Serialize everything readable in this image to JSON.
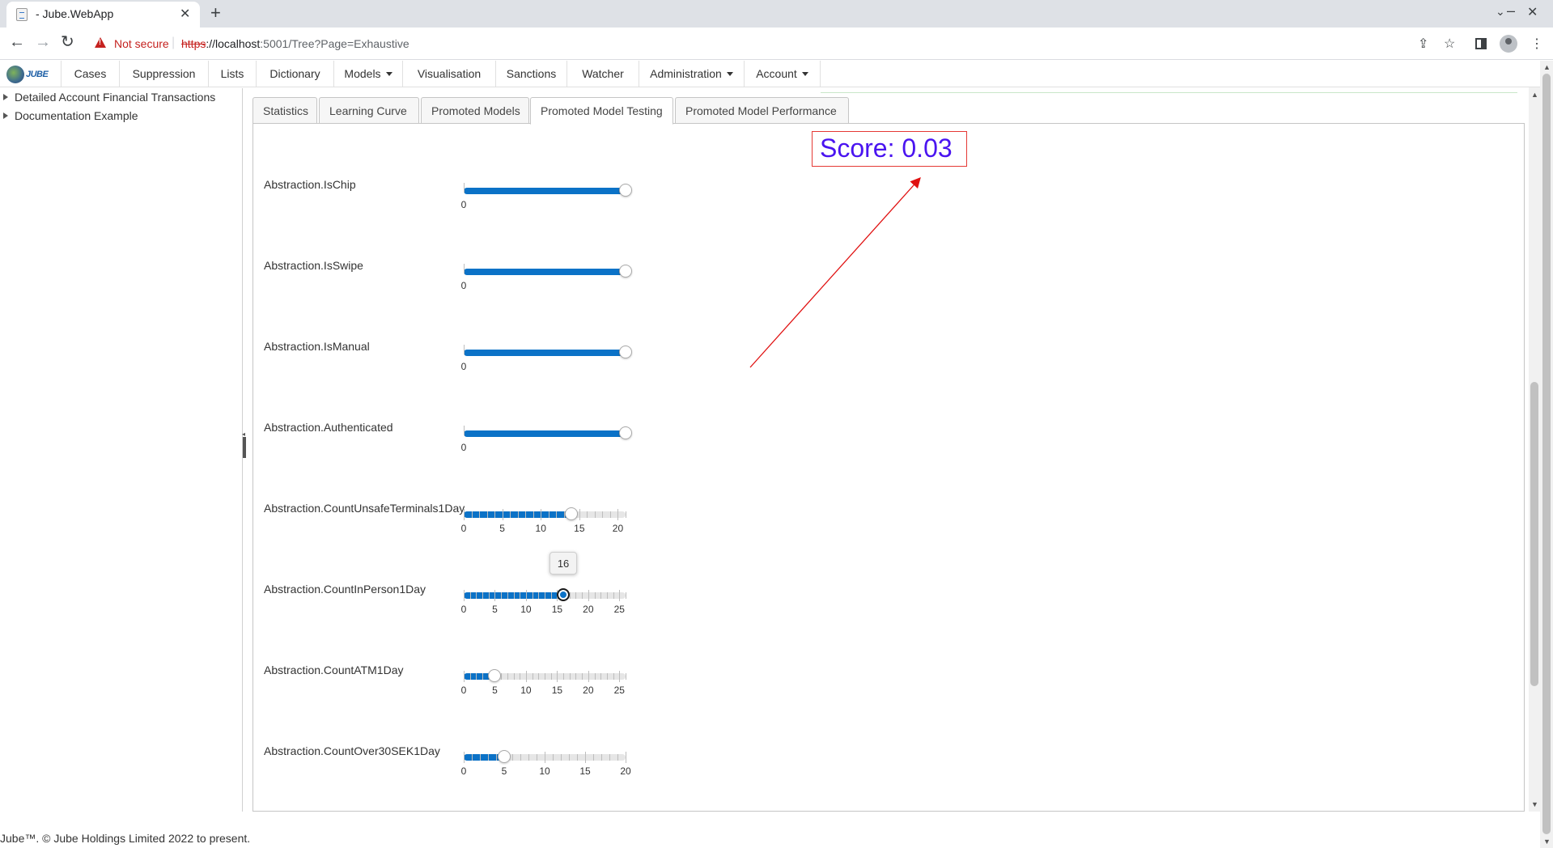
{
  "browser": {
    "tab_title": "- Jube.WebApp",
    "security_label": "Not secure",
    "url_scheme": "https",
    "url_host": "://localhost",
    "url_rest": ":5001/Tree?Page=Exhaustive"
  },
  "navbar": {
    "logo_text": "JUBE",
    "items": [
      {
        "label": "Cases"
      },
      {
        "label": "Suppression"
      },
      {
        "label": "Lists"
      },
      {
        "label": "Dictionary"
      },
      {
        "label": "Models",
        "dropdown": true
      },
      {
        "label": "Visualisation"
      },
      {
        "label": "Sanctions"
      },
      {
        "label": "Watcher"
      },
      {
        "label": "Administration",
        "dropdown": true
      },
      {
        "label": "Account",
        "dropdown": true
      }
    ]
  },
  "tree": {
    "items": [
      {
        "label": "Detailed Account Financial Transactions"
      },
      {
        "label": "Documentation Example"
      }
    ]
  },
  "tabs": [
    {
      "label": "Statistics"
    },
    {
      "label": "Learning Curve"
    },
    {
      "label": "Promoted Models"
    },
    {
      "label": "Promoted Model Testing",
      "active": true
    },
    {
      "label": "Promoted Model Performance"
    }
  ],
  "score": {
    "label": "Score: 0.03",
    "color": "#4a14f0",
    "border_color": "#e53935"
  },
  "annotation": {
    "arrow_color": "#e01010"
  },
  "sliders": [
    {
      "name": "Abstraction.IsChip",
      "min": 0,
      "max": 0,
      "value": 0,
      "tick_labels": [
        "0"
      ]
    },
    {
      "name": "Abstraction.IsSwipe",
      "min": 0,
      "max": 0,
      "value": 0,
      "tick_labels": [
        "0"
      ]
    },
    {
      "name": "Abstraction.IsManual",
      "min": 0,
      "max": 0,
      "value": 0,
      "tick_labels": [
        "0"
      ]
    },
    {
      "name": "Abstraction.Authenticated",
      "min": 0,
      "max": 0,
      "value": 0,
      "tick_labels": [
        "0"
      ]
    },
    {
      "name": "Abstraction.CountUnsafeTerminals1Day",
      "min": 0,
      "max": 21,
      "value": 14,
      "tick_labels": [
        "0",
        "5",
        "10",
        "15",
        "20"
      ]
    },
    {
      "name": "Abstraction.CountInPerson1Day",
      "min": 0,
      "max": 26,
      "value": 16,
      "tick_labels": [
        "0",
        "5",
        "10",
        "15",
        "20",
        "25"
      ],
      "tooltip": "16"
    },
    {
      "name": "Abstraction.CountATM1Day",
      "min": 0,
      "max": 26,
      "value": 5,
      "tick_labels": [
        "0",
        "5",
        "10",
        "15",
        "20",
        "25"
      ]
    },
    {
      "name": "Abstraction.CountOver30SEK1Day",
      "min": 0,
      "max": 20,
      "value": 5,
      "tick_labels": [
        "0",
        "5",
        "10",
        "15",
        "20"
      ]
    }
  ],
  "footer": {
    "text": "Jube™. © Jube Holdings Limited 2022 to present."
  }
}
